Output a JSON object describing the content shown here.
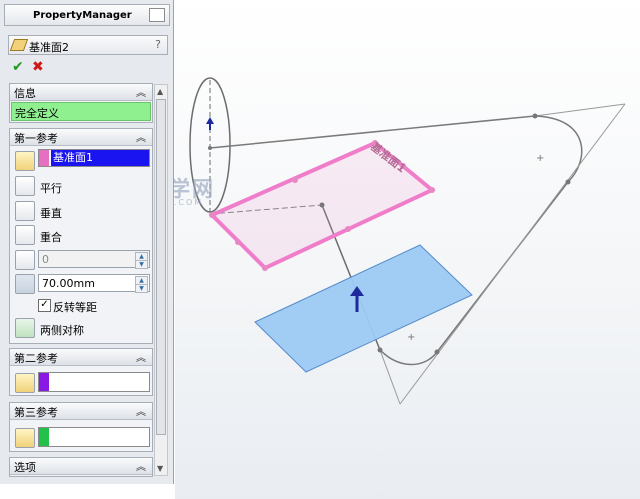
{
  "property_manager": {
    "title": "PropertyManager",
    "feature_name": "基准面2",
    "help": "?",
    "ok": "✔",
    "cancel": "✖"
  },
  "info": {
    "header": "信息",
    "status": "完全定义"
  },
  "first_ref": {
    "header": "第一参考",
    "selection": "基准面1",
    "selection_color": "#e76fc2",
    "options": [
      {
        "label": "平行"
      },
      {
        "label": "垂直"
      },
      {
        "label": "重合"
      }
    ],
    "angle_value": "0",
    "distance_value": "70.00mm",
    "flip_label": "反转等距",
    "flip_checked": true,
    "symmetric_label": "两侧对称"
  },
  "second_ref": {
    "header": "第二参考",
    "color": "#8a19e6"
  },
  "third_ref": {
    "header": "第三参考",
    "color": "#22c24a"
  },
  "options": {
    "header": "选项"
  },
  "watermark": {
    "text": "软件自学网",
    "sub": "RJZXW.COM"
  },
  "plane_label": "基准面1",
  "colors": {
    "ok": "#1f9a1f",
    "cancel": "#d01818",
    "info_bg": "#8ff08f",
    "selection_bg": "#1a14f0",
    "plane_pink": "#f07dc9",
    "plane_blue": "#9dcbf5"
  }
}
